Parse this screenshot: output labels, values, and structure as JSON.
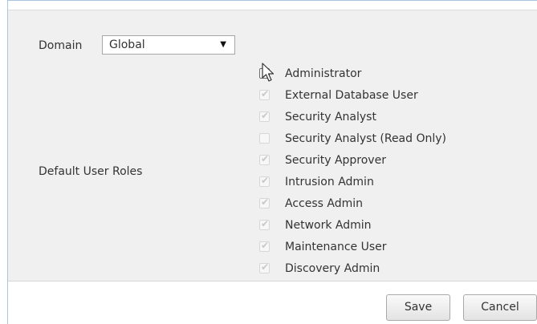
{
  "domain": {
    "label": "Domain",
    "selected_value": "Global"
  },
  "roles": {
    "label": "Default User Roles",
    "items": [
      {
        "label": "Administrator",
        "checked": true,
        "enabled": true
      },
      {
        "label": "External Database User",
        "checked": true,
        "enabled": false
      },
      {
        "label": "Security Analyst",
        "checked": true,
        "enabled": false
      },
      {
        "label": "Security Analyst (Read Only)",
        "checked": false,
        "enabled": false
      },
      {
        "label": "Security Approver",
        "checked": true,
        "enabled": false
      },
      {
        "label": "Intrusion Admin",
        "checked": true,
        "enabled": false
      },
      {
        "label": "Access Admin",
        "checked": true,
        "enabled": false
      },
      {
        "label": "Network Admin",
        "checked": true,
        "enabled": false
      },
      {
        "label": "Maintenance User",
        "checked": true,
        "enabled": false
      },
      {
        "label": "Discovery Admin",
        "checked": true,
        "enabled": false
      }
    ]
  },
  "buttons": {
    "save_label": "Save",
    "cancel_label": "Cancel"
  },
  "icons": {
    "dropdown": "chevron-down-icon",
    "pointer": "mouse-pointer-icon"
  },
  "colors": {
    "panel_background": "#f0f0f0",
    "frame_border": "#a9c6e0"
  }
}
